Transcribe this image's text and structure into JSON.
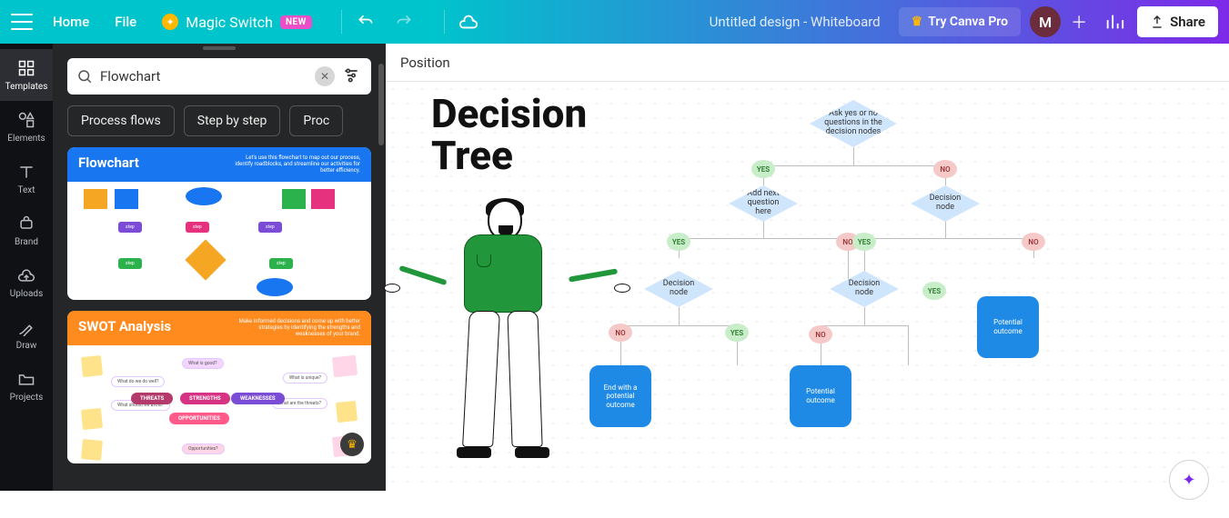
{
  "topbar": {
    "home": "Home",
    "file": "File",
    "magic": "Magic Switch",
    "new": "NEW",
    "doc_title": "Untitled design - Whiteboard",
    "try_pro": "Try Canva Pro",
    "avatar_initial": "M",
    "share": "Share"
  },
  "rail": {
    "templates": "Templates",
    "elements": "Elements",
    "text": "Text",
    "brand": "Brand",
    "uploads": "Uploads",
    "draw": "Draw",
    "projects": "Projects"
  },
  "panel": {
    "search_value": "Flowchart",
    "chips": [
      "Process flows",
      "Step by step",
      "Proc"
    ],
    "thumb1": {
      "title": "Flowchart",
      "sub": "Let's use this flowchart to map out our process, identify roadblocks, and streamline our activities for better efficiency."
    },
    "thumb2": {
      "title": "SWOT Analysis",
      "sub": "Make informed decisions and come up with better strategies by identifying the strengths and weaknesses of your brand.",
      "center": {
        "s": "STRENGTHS",
        "w": "WEAKNESSES",
        "o": "OPPORTUNITIES",
        "t": "THREATS"
      }
    }
  },
  "canvas": {
    "position_label": "Position",
    "title": "Decision\nTree",
    "nodes": {
      "root": "Ask yes or no questions in the decision nodes",
      "addq": "Add next question here",
      "decision": "Decision node",
      "yes": "YES",
      "no": "NO",
      "outcome_end": "End with a potential outcome",
      "outcome": "Potential outcome"
    }
  }
}
